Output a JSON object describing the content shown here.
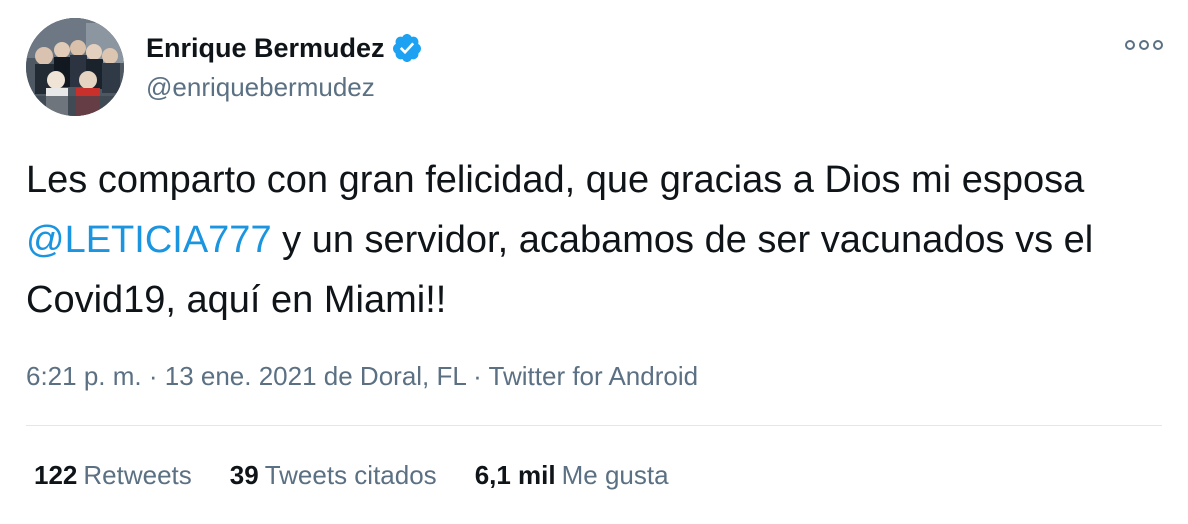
{
  "author": {
    "display_name": "Enrique Bermudez",
    "handle": "@enriquebermudez",
    "verified": true
  },
  "tweet": {
    "text_before": "Les comparto con gran felicidad, que gracias a Dios mi esposa ",
    "mention": "@LETICIA777",
    "text_after": " y un servidor, acabamos de ser vacunados vs el Covid19, aquí en Miami!!"
  },
  "meta": {
    "time": "6:21 p. m.",
    "sep1": " · ",
    "date": "13 ene. 2021",
    "location_prefix": " de ",
    "location": "Doral, FL",
    "sep2": " · ",
    "source": "Twitter for Android"
  },
  "stats": {
    "retweets_count": "122",
    "retweets_label": "Retweets",
    "quotes_count": "39",
    "quotes_label": "Tweets citados",
    "likes_count": "6,1 mil",
    "likes_label": "Me gusta"
  },
  "colors": {
    "accent": "#1b95e0",
    "secondary_text": "#5b7083",
    "verified_badge": "#1da1f2",
    "divider": "#e1e8ed"
  },
  "icons": {
    "verified": "verified-badge-icon",
    "more": "more-options-icon"
  }
}
